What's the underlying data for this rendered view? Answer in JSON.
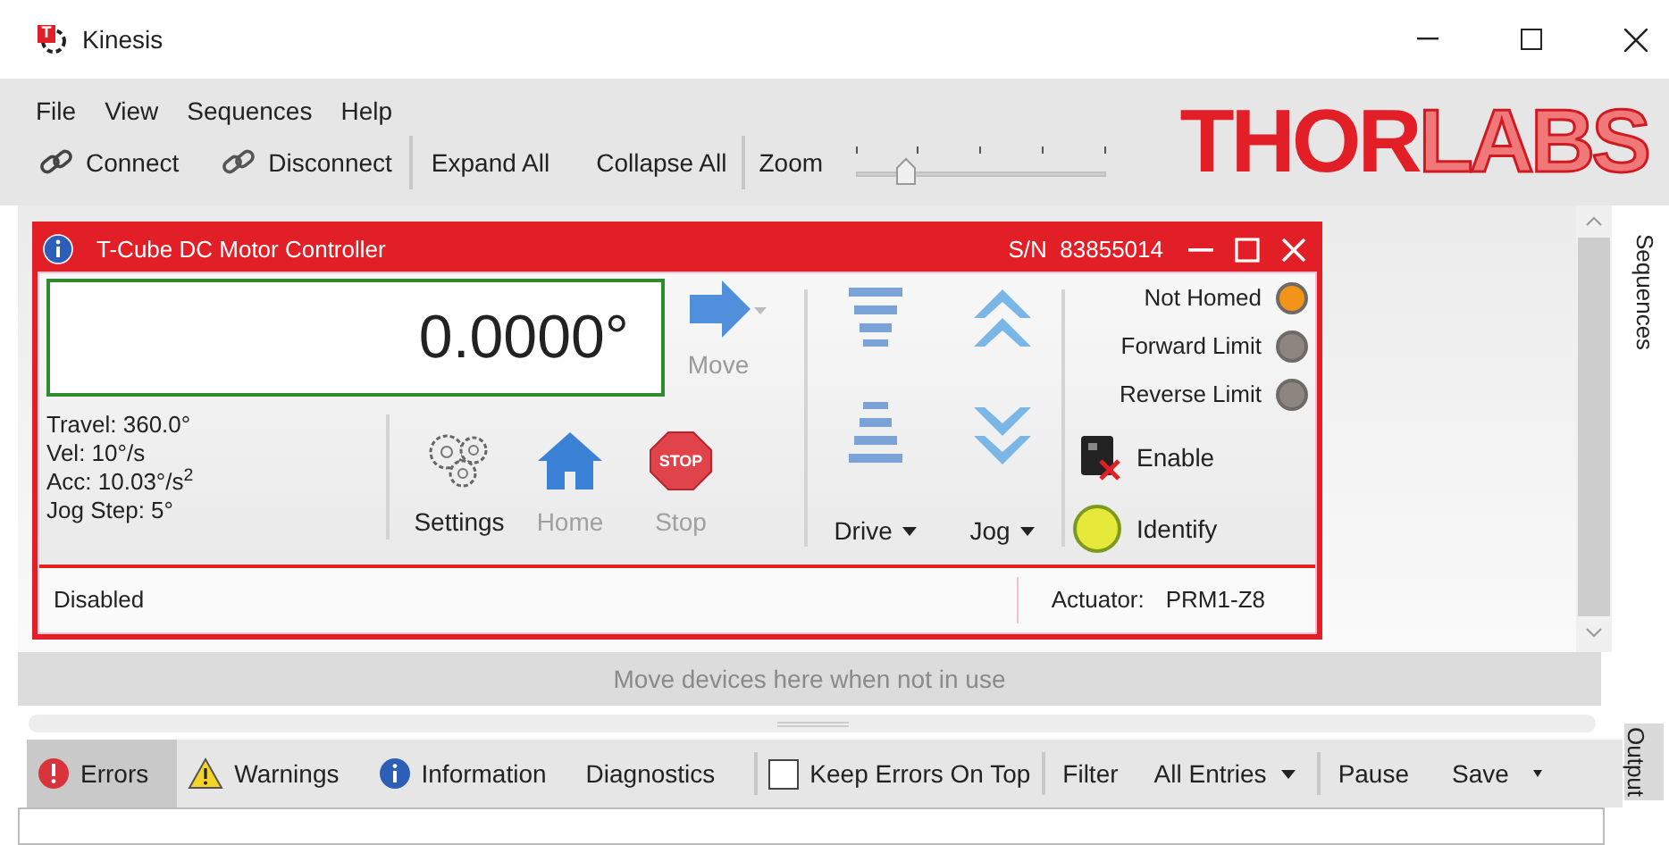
{
  "window": {
    "title": "Kinesis",
    "app_icon": "T"
  },
  "menu": [
    "File",
    "View",
    "Sequences",
    "Help"
  ],
  "toolbar": {
    "connect": "Connect",
    "disconnect": "Disconnect",
    "expand": "Expand All",
    "collapse": "Collapse All",
    "zoom": {
      "label": "Zoom",
      "level": 0.2
    }
  },
  "logo": {
    "solid": "THOR",
    "outline": "LABS"
  },
  "device": {
    "title": "T-Cube DC Motor Controller",
    "serial_label": "S/N",
    "serial": "83855014",
    "position": "0.0000°",
    "move": {
      "label": "Move",
      "disabled": true
    },
    "params": [
      "Travel: 360.0°",
      "Vel: 10°/s",
      "Acc: 10.03°/s$^{2}$",
      "Jog Step: 5°"
    ],
    "actions": [
      {
        "kind": "settings",
        "label": "Settings",
        "disabled": false
      },
      {
        "kind": "home",
        "label": "Home",
        "disabled": true
      },
      {
        "kind": "stop",
        "label": "Stop",
        "disabled": true,
        "sign": "STOP"
      }
    ],
    "drive": "Drive",
    "jog": "Jog",
    "indicators": [
      {
        "label": "Not Homed",
        "color": "#f29418"
      },
      {
        "label": "Forward Limit",
        "color": "#8c8580"
      },
      {
        "label": "Reverse Limit",
        "color": "#8c8580"
      }
    ],
    "enable": "Enable",
    "identify": "Identify",
    "status": "Disabled",
    "actuator_label": "Actuator:",
    "actuator": "PRM1-Z8"
  },
  "dock": "Move devices here when not in use",
  "side_tabs": [
    "Sequences",
    "Output"
  ],
  "output": {
    "tabs": [
      {
        "kind": "error",
        "label": "Errors",
        "selected": true
      },
      {
        "kind": "warning",
        "label": "Warnings",
        "selected": false
      },
      {
        "kind": "info",
        "label": "Information",
        "selected": false
      },
      {
        "kind": "plain",
        "label": "Diagnostics",
        "selected": false
      }
    ],
    "keep_on_top": {
      "label": "Keep Errors On Top",
      "checked": false
    },
    "filter": "Filter",
    "filter_value": "All Entries",
    "pause": "Pause",
    "save": "Save"
  }
}
